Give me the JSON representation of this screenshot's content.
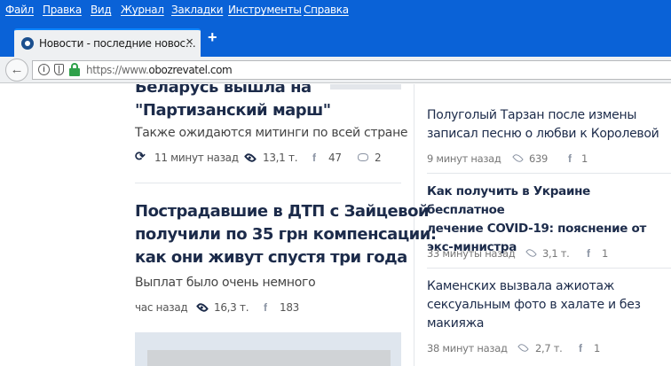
{
  "browser": {
    "menu": [
      "Файл",
      "Правка",
      "Вид",
      "Журнал",
      "Закладки",
      "Инструменты",
      "Справка"
    ],
    "tab_title": "Новости - последние новос…",
    "tab_close": "×",
    "new_tab": "+",
    "url_scheme": "https://www.",
    "url_host": "obozrevatel.com",
    "back": "←",
    "info": "i"
  },
  "articles": [
    {
      "title_lines": [
        "Беларусь вышла на",
        "\"Партизанский марш\""
      ],
      "lead": "Также ожидаются митинги по всей стране",
      "time": "11 минут назад",
      "views": "13,1 т.",
      "shares": "47",
      "comments": "2",
      "updated_icon": "refresh-icon"
    },
    {
      "title_lines": [
        "Пострадавшие в ДТП с Зайцевой",
        "получили по 35 грн компенсации:",
        "как они живут спустя три года"
      ],
      "lead": "Выплат было очень немного",
      "time": "час назад",
      "views": "16,3 т.",
      "shares": "183"
    }
  ],
  "sidebar": [
    {
      "title_lines": [
        "Полуголый Тарзан после измены",
        "записал песню о любви к Королевой"
      ],
      "bold": false,
      "time": "9 минут назад",
      "views": "639",
      "shares": "1"
    },
    {
      "title_lines": [
        "Как получить в Украине бесплатное",
        "лечение COVID-19: пояснение от",
        "экс-министра"
      ],
      "bold": true,
      "time": "33 минуты назад",
      "views": "3,1 т.",
      "shares": "1"
    },
    {
      "title_lines": [
        "Каменских вызвала ажиотаж",
        "сексуальным фото в халате и без",
        "макияжа"
      ],
      "bold": false,
      "time": "38 минут назад",
      "views": "2,7 т.",
      "shares": "1"
    }
  ],
  "icons": {
    "views": "eye-icon",
    "shares": "facebook-icon",
    "comments": "comment-icon",
    "security": "lock-icon",
    "tracking": "shield-icon"
  },
  "colors": {
    "chrome_blue": "#0a62d7",
    "headline": "#1c2b4a",
    "lock_green": "#2fa14a"
  }
}
